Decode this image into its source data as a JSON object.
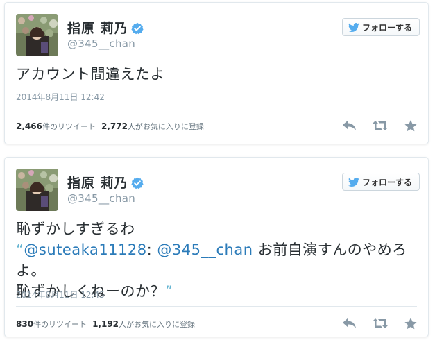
{
  "tweets": [
    {
      "name": "指原 莉乃",
      "handle": "@345__chan",
      "follow_label": "フォローする",
      "text": "アカウント間違えたよ",
      "timestamp": "2014年8月11日  12:42",
      "retweets_count": "2,466",
      "retweets_label": "件のリツイート",
      "favorites_count": "2,772",
      "favorites_label": "人がお気に入りに登録"
    },
    {
      "name": "指原 莉乃",
      "handle": "@345__chan",
      "follow_label": "フォローする",
      "text_line1": "恥ずかしすぎるわ",
      "quote_open": "“",
      "mention1": "@suteaka11128",
      "colon": ": ",
      "mention2": "@345__chan",
      "text_rest": " お前自演すんのやめろよ。",
      "text_line3": "恥ずかしくねーのか？",
      "quote_close": "”",
      "timestamp": "2014年8月11日  12:45",
      "retweets_count": "830",
      "retweets_label": "件のリツイート",
      "favorites_count": "1,192",
      "favorites_label": "人がお気に入りに登録"
    }
  ],
  "icons": {
    "verified": "verified-badge-icon",
    "bird": "twitter-bird-icon",
    "reply": "reply-icon",
    "retweet": "retweet-icon",
    "favorite": "star-icon"
  },
  "colors": {
    "link": "#2b7bb9",
    "quote": "#66b5d2",
    "verified": "#55acee",
    "muted": "#8899a6",
    "action_icon": "#8899a6"
  }
}
